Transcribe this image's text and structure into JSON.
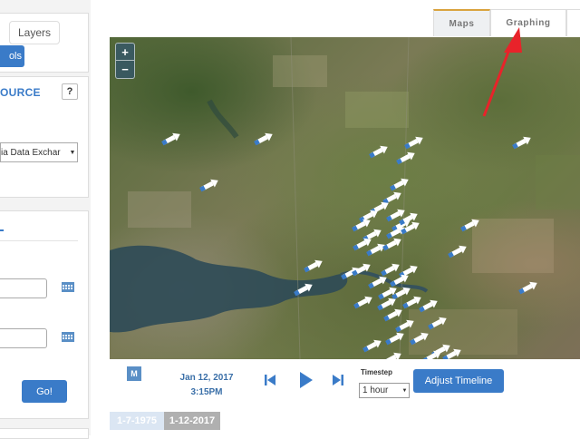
{
  "left_panel": {
    "layers_tab": "Layers",
    "tools_button": "ols",
    "source_title": "OURCE",
    "help_button": "?",
    "source_value": "ia Data Exchar",
    "go_button": "Go!"
  },
  "top_tabs": [
    {
      "label": "Maps",
      "active": true
    },
    {
      "label": "Graphing",
      "active": false
    }
  ],
  "map": {
    "zoom_in": "+",
    "zoom_out": "−",
    "marker_icon": "wind-arrow-icon",
    "accent_color": "#3a7bc8"
  },
  "controls": {
    "m_button": "M",
    "current_date": "Jan 12, 2017",
    "current_time": "3:15PM",
    "timestep_label": "Timestep",
    "timestep_value": "1 hour",
    "adjust_timeline": "Adjust Timeline",
    "range_start": "1-7-1975",
    "range_end": "1-12-2017"
  },
  "annotation": {
    "color": "#e8232a"
  }
}
